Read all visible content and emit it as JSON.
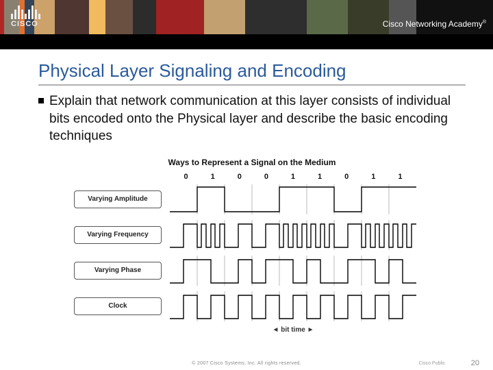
{
  "header": {
    "brand": "CISCO",
    "academy": "Cisco Networking Academy",
    "trademark": "®"
  },
  "title": "Physical Layer Signaling and Encoding",
  "bullet": "Explain that network communication at this layer consists of individual bits encoded onto the Physical layer and describe the basic encoding techniques",
  "diagram": {
    "title": "Ways to Represent a Signal on the Medium",
    "bits": [
      "0",
      "1",
      "0",
      "0",
      "1",
      "1",
      "0",
      "1",
      "1"
    ],
    "rows": {
      "amp": "Varying Amplitude",
      "freq": "Varying Frequency",
      "phase": "Varying Phase",
      "clock": "Clock"
    },
    "axis": "bit time",
    "axis_arrow": "→"
  },
  "footer": {
    "copyright": "© 2007 Cisco Systems, Inc. All rights reserved.",
    "right": "Cisco Public",
    "page": "20"
  },
  "chart_data": {
    "type": "line",
    "title": "Ways to Represent a Signal on the Medium",
    "categories": [
      "0",
      "1",
      "0",
      "0",
      "1",
      "1",
      "0",
      "1",
      "1"
    ],
    "xlabel": "bit time",
    "ylabel": "",
    "series": [
      {
        "name": "Varying Amplitude",
        "description": "High amplitude square pulse on 1-bits, low/baseline on 0-bits"
      },
      {
        "name": "Varying Frequency",
        "description": "Higher-frequency square wave during 1-bits, lower frequency during 0-bits"
      },
      {
        "name": "Varying Phase",
        "description": "Square wave with phase flip at 0→1 transitions"
      },
      {
        "name": "Clock",
        "description": "Constant-period square wave, one cycle per bit time"
      }
    ]
  }
}
